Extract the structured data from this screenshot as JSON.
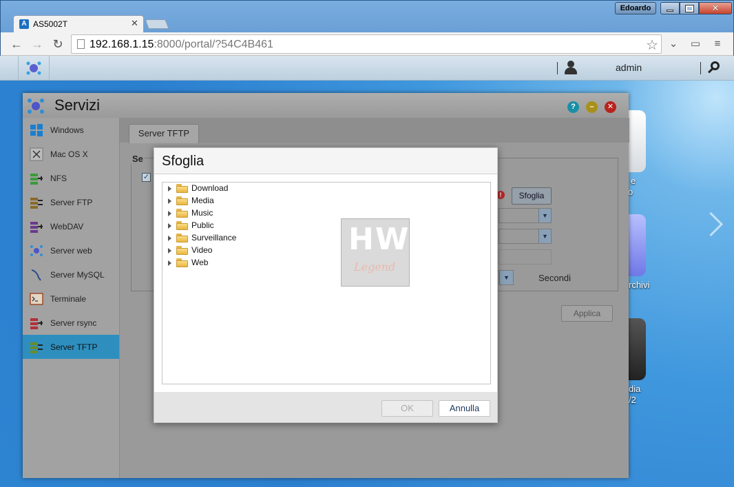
{
  "window": {
    "os_user": "Edoardo",
    "tab_title": "AS5002T",
    "tab_favicon": "A"
  },
  "address_bar": {
    "host": "192.168.1.15",
    "rest": ":8000/portal/?54C4B461"
  },
  "appbar": {
    "user": "admin"
  },
  "desktop_labels": {
    "label1": "e",
    "label2": "o",
    "label3": "rchivi",
    "label4": "dia",
    "label5": "/2"
  },
  "services_window": {
    "title": "Servizi",
    "sidebar": [
      {
        "label": "Windows"
      },
      {
        "label": "Mac OS X"
      },
      {
        "label": "NFS"
      },
      {
        "label": "Server FTP"
      },
      {
        "label": "WebDAV"
      },
      {
        "label": "Server web"
      },
      {
        "label": "Server MySQL"
      },
      {
        "label": "Terminale"
      },
      {
        "label": "Server rsync"
      },
      {
        "label": "Server TFTP"
      }
    ],
    "selected_item": "Server TFTP",
    "tab": "Server TFTP",
    "section_legend": "Se",
    "browse_button": "Sfoglia",
    "seconds_label": "Secondi",
    "apply_button": "Applica"
  },
  "dialog": {
    "title": "Sfoglia",
    "folders": [
      "Download",
      "Media",
      "Music",
      "Public",
      "Surveillance",
      "Video",
      "Web"
    ],
    "ok_button": "OK",
    "cancel_button": "Annulla"
  },
  "watermark": {
    "top": "HW",
    "bottom": "Legend"
  },
  "colors": {
    "selected_sidebar": "#2e8fbf",
    "close_button": "#b8231d",
    "help_button": "#1a8fa6",
    "minimize_button": "#a8901a"
  }
}
